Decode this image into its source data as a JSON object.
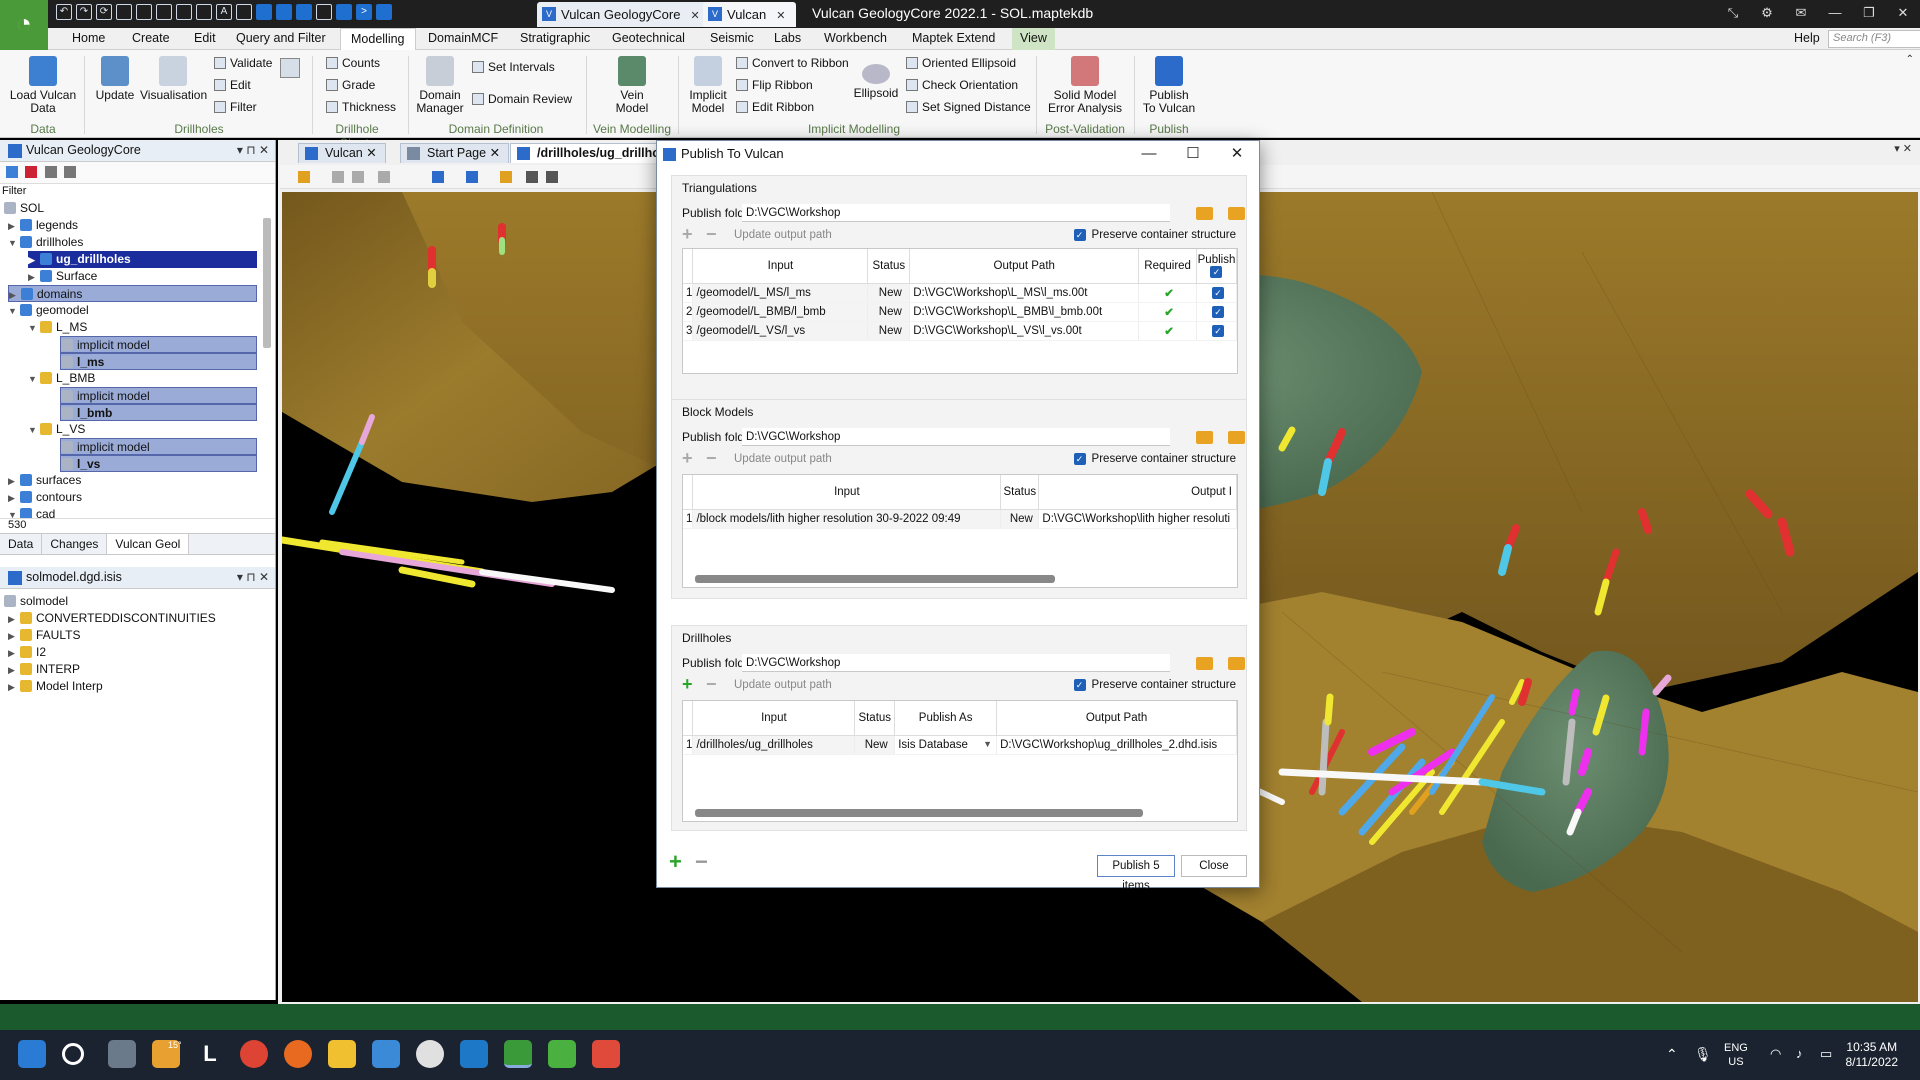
{
  "titlebar": {
    "tabs": [
      {
        "label": "Vulcan GeologyCore"
      },
      {
        "label": "Vulcan"
      }
    ],
    "window_title": "Vulcan GeologyCore 2022.1 - SOL.maptekdb",
    "close_glyph": "✕"
  },
  "menubar": {
    "items": [
      "Home",
      "Create",
      "Edit",
      "Query and Filter",
      "Modelling",
      "DomainMCF",
      "Stratigraphic",
      "Geotechnical",
      "Seismic",
      "Labs",
      "Workbench",
      "Maptek Extend",
      "View"
    ],
    "active": "Modelling",
    "help": "Help",
    "search_placeholder": "Search (F3)"
  },
  "ribbon": {
    "buttons": {
      "load_vulcan_data": "Load Vulcan\nData",
      "update": "Update",
      "visualisation": "Visualisation",
      "validate": "Validate",
      "edit": "Edit",
      "filter": "Filter",
      "counts": "Counts",
      "grade": "Grade",
      "thickness": "Thickness",
      "domain_manager": "Domain\nManager",
      "set_intervals": "Set Intervals",
      "domain_review": "Domain Review",
      "vein_model": "Vein\nModel",
      "implicit_model": "Implicit\nModel",
      "convert_to_ribbon": "Convert to Ribbon",
      "flip_ribbon": "Flip Ribbon",
      "edit_ribbon": "Edit Ribbon",
      "ellipsoid": "Ellipsoid",
      "oriented_ellipsoid": "Oriented Ellipsoid",
      "check_orientation": "Check Orientation",
      "set_signed_distance": "Set Signed Distance",
      "solid_model_error_analysis": "Solid Model\nError Analysis",
      "publish_to_vulcan": "Publish\nTo Vulcan"
    },
    "groups": [
      "Data",
      "Drillholes",
      "Drillhole Charts",
      "Domain Definition",
      "Vein Modelling",
      "Implicit Modelling",
      "Post-Validation",
      "Publish"
    ]
  },
  "left_top_pane": {
    "title": "Vulcan GeologyCore",
    "filter_label": "Filter",
    "tree": [
      "SOL",
      "legends",
      "drillholes",
      "ug_drillholes",
      "Surface",
      "domains",
      "geomodel",
      "L_MS",
      "implicit model",
      "l_ms",
      "L_BMB",
      "implicit model",
      "l_bmb",
      "L_VS",
      "implicit model",
      "l_vs",
      "surfaces",
      "contours",
      "cad"
    ],
    "count": "530",
    "tabs": [
      "Data",
      "Changes",
      "Vulcan Geol"
    ]
  },
  "left_bottom_pane": {
    "title": "solmodel.dgd.isis",
    "tree": [
      "solmodel",
      "CONVERTEDDISCONTINUITIES",
      "FAULTS",
      "I2",
      "INTERP",
      "Model Interp"
    ]
  },
  "doc_tabs": [
    "Vulcan",
    "Start Page",
    "/drillholes/ug_drillho"
  ],
  "dialog": {
    "title": "Publish To Vulcan",
    "triangulations": {
      "title": "Triangulations",
      "publish_folder_label": "Publish folder",
      "publish_folder": "D:\\VGC\\Workshop",
      "update_output_path": "Update output path",
      "preserve": "Preserve container structure",
      "columns": [
        "Input",
        "Status",
        "Output Path",
        "Required",
        "Publish"
      ],
      "rows": [
        {
          "n": "1",
          "input": "/geomodel/L_MS/l_ms",
          "status": "New",
          "output": "D:\\VGC\\Workshop\\L_MS\\l_ms.00t"
        },
        {
          "n": "2",
          "input": "/geomodel/L_BMB/l_bmb",
          "status": "New",
          "output": "D:\\VGC\\Workshop\\L_BMB\\l_bmb.00t"
        },
        {
          "n": "3",
          "input": "/geomodel/L_VS/l_vs",
          "status": "New",
          "output": "D:\\VGC\\Workshop\\L_VS\\l_vs.00t"
        }
      ]
    },
    "block_models": {
      "title": "Block Models",
      "publish_folder_label": "Publish folder",
      "publish_folder": "D:\\VGC\\Workshop",
      "update_output_path": "Update output path",
      "preserve": "Preserve container structure",
      "columns": [
        "Input",
        "Status",
        "Output I"
      ],
      "rows": [
        {
          "n": "1",
          "input": "/block models/lith higher resolution 30-9-2022 09:49",
          "status": "New",
          "output": "D:\\VGC\\Workshop\\lith higher resoluti"
        }
      ]
    },
    "drillholes": {
      "title": "Drillholes",
      "publish_folder_label": "Publish folder",
      "publish_folder": "D:\\VGC\\Workshop",
      "update_output_path": "Update output path",
      "preserve": "Preserve container structure",
      "columns": [
        "Input",
        "Status",
        "Publish As",
        "Output Path"
      ],
      "rows": [
        {
          "n": "1",
          "input": "/drillholes/ug_drillholes",
          "status": "New",
          "publish_as": "Isis Database",
          "output": "D:\\VGC\\Workshop\\ug_drillholes_2.dhd.isis"
        }
      ]
    },
    "publish_button": "Publish 5 items",
    "close_button": "Close"
  },
  "taskbar": {
    "weather": "15°",
    "lang": "ENG\nUS",
    "time": "10:35 AM",
    "date": "8/11/2022"
  },
  "colors": {
    "brand_green": "#4a9a3a",
    "status_green": "#1b5a2c",
    "selection": "#9aabd8",
    "surface_brown": "#9a7a2c",
    "solid_green": "#5a7a60"
  }
}
